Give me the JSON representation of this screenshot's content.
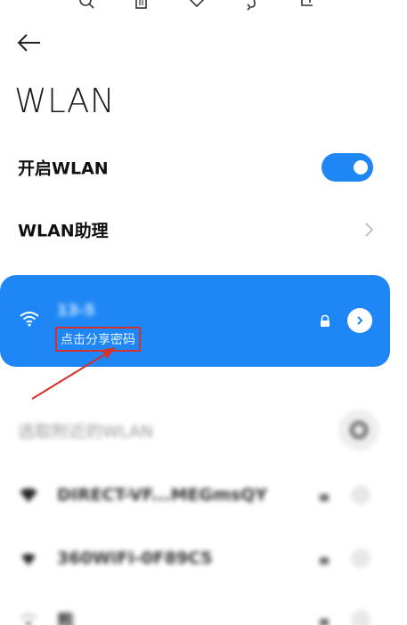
{
  "header": {
    "title": "WLAN"
  },
  "settings": {
    "enable_label": "开启WLAN",
    "enable_on": true,
    "assistant_label": "WLAN助理"
  },
  "connected": {
    "ssid": "13-5",
    "share_text": "点击分享密码"
  },
  "nearby": {
    "section_label": "选取附近的WLAN",
    "networks": [
      {
        "name": "DIRECT-VF...MEGmsQY"
      },
      {
        "name": "360WiFi-0F89C5"
      },
      {
        "name": "熊"
      }
    ]
  },
  "colors": {
    "accent": "#1f87f5",
    "annotation": "#d6302a"
  }
}
